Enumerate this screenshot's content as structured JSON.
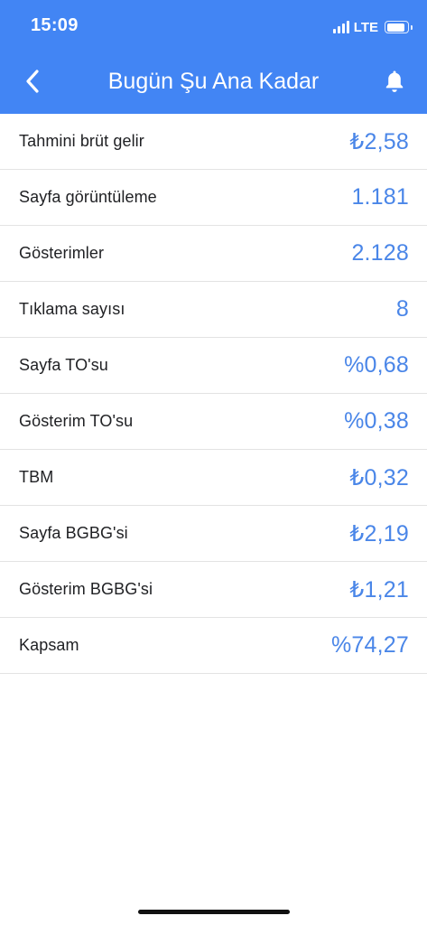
{
  "status_bar": {
    "time": "15:09",
    "network": "LTE"
  },
  "header": {
    "title": "Bugün Şu Ana Kadar",
    "back_icon": "chevron-left-icon",
    "bell_icon": "bell-icon",
    "background_color": "#4285f4"
  },
  "metrics": [
    {
      "label": "Tahmini brüt gelir",
      "value": "₺2,58"
    },
    {
      "label": "Sayfa görüntüleme",
      "value": "1.181"
    },
    {
      "label": "Gösterimler",
      "value": "2.128"
    },
    {
      "label": "Tıklama sayısı",
      "value": "8"
    },
    {
      "label": "Sayfa TO'su",
      "value": "%0,68"
    },
    {
      "label": "Gösterim TO'su",
      "value": "%0,38"
    },
    {
      "label": "TBM",
      "value": "₺0,32"
    },
    {
      "label": "Sayfa BGBG'si",
      "value": "₺2,19"
    },
    {
      "label": "Gösterim BGBG'si",
      "value": "₺1,21"
    },
    {
      "label": "Kapsam",
      "value": "%74,27"
    }
  ],
  "colors": {
    "accent": "#4285f4",
    "value_text": "#4a86e8",
    "label_text": "#202124"
  }
}
